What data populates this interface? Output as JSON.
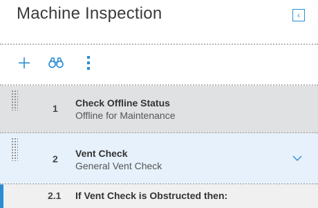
{
  "header": {
    "title": "Machine Inspection",
    "collapse_icon": "chevron-left-icon"
  },
  "toolbar": {
    "items": [
      {
        "icon": "plus-icon"
      },
      {
        "icon": "binoculars-icon"
      },
      {
        "icon": "more-vertical-icon"
      }
    ],
    "accent_color": "#2a8dd4"
  },
  "steps": [
    {
      "number": "1",
      "title": "Check Offline Status",
      "subtitle": "Offline for Maintenance"
    },
    {
      "number": "2",
      "title": "Vent Check",
      "subtitle": "General Vent Check"
    },
    {
      "number": "2.1",
      "title": "If Vent Check is Obstructed then:",
      "subtitle": ""
    }
  ]
}
